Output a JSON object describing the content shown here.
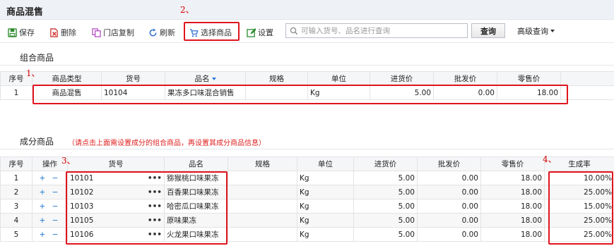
{
  "window": {
    "title": "商品混售"
  },
  "toolbar": {
    "save": "保存",
    "delete": "删除",
    "store_copy": "门店复制",
    "refresh": "刷新",
    "select_goods": "选择商品",
    "settings": "设置",
    "search_placeholder": "可输入货号、品名进行查询",
    "query": "查询",
    "advanced_query": "高级查询"
  },
  "combo": {
    "section_title": "组合商品",
    "columns": [
      "序号",
      "商品类型",
      "货号",
      "品名",
      "规格",
      "单位",
      "进货价",
      "批发价",
      "零售价"
    ],
    "rows": [
      {
        "seq": "1",
        "type": "商品混售",
        "code": "10104",
        "name": "果冻多口味混合销售",
        "spec": "",
        "unit": "Kg",
        "purchase": "5.00",
        "wholesale": "0.00",
        "retail": "18.00"
      }
    ]
  },
  "component": {
    "section_title": "成分商品",
    "hint": "（请点击上面需设置成分的组合商品，再设置其成分商品信息）",
    "columns": [
      "序号",
      "操作",
      "货号",
      "品名",
      "规格",
      "单位",
      "进货价",
      "批发价",
      "零售价",
      "生成率"
    ],
    "ops": "+ −",
    "picker": "•••",
    "rows": [
      {
        "seq": "1",
        "code": "10101",
        "name": "猕猴桃口味果冻",
        "spec": "",
        "unit": "Kg",
        "purchase": "5.00",
        "wholesale": "0.00",
        "retail": "18.00",
        "rate": "10.00%"
      },
      {
        "seq": "2",
        "code": "10102",
        "name": "百香果口味果冻",
        "spec": "",
        "unit": "Kg",
        "purchase": "5.00",
        "wholesale": "0.00",
        "retail": "18.00",
        "rate": "25.00%"
      },
      {
        "seq": "3",
        "code": "10103",
        "name": "哈密瓜口味果冻",
        "spec": "",
        "unit": "Kg",
        "purchase": "5.00",
        "wholesale": "0.00",
        "retail": "18.00",
        "rate": "15.00%"
      },
      {
        "seq": "4",
        "code": "10105",
        "name": "原味果冻",
        "spec": "",
        "unit": "Kg",
        "purchase": "5.00",
        "wholesale": "0.00",
        "retail": "18.00",
        "rate": "25.00%"
      },
      {
        "seq": "5",
        "code": "10106",
        "name": "火龙果口味果冻",
        "spec": "",
        "unit": "Kg",
        "purchase": "5.00",
        "wholesale": "0.00",
        "retail": "18.00",
        "rate": "25.00%"
      }
    ]
  },
  "annotations": {
    "a1": "1、",
    "a2": "2、",
    "a3": "3、",
    "a4": "4、"
  },
  "colors": {
    "accent_blue": "#1a73d1",
    "annotation_red": "#e0141e",
    "header_bg": "#f5f6f8"
  }
}
